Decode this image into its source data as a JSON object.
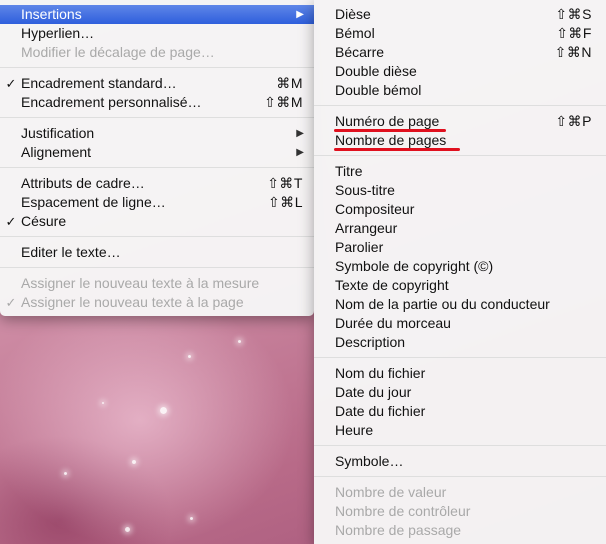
{
  "main_menu": {
    "items": [
      {
        "label": "Insertions",
        "submenu": true,
        "highlighted": true
      },
      {
        "label": "Hyperlien…"
      },
      {
        "label": "Modifier le décalage de page…",
        "disabled": true
      },
      {
        "label": "Encadrement standard…",
        "checked": true,
        "shortcut": "⌘M"
      },
      {
        "label": "Encadrement personnalisé…",
        "shortcut": "⇧⌘M"
      },
      {
        "label": "Justification",
        "submenu": true
      },
      {
        "label": "Alignement",
        "submenu": true
      },
      {
        "label": "Attributs de cadre…",
        "shortcut": "⇧⌘T"
      },
      {
        "label": "Espacement de ligne…",
        "shortcut": "⇧⌘L"
      },
      {
        "label": "Césure",
        "checked": true
      },
      {
        "label": "Editer le texte…"
      },
      {
        "label": "Assigner le nouveau texte à la mesure",
        "disabled": true
      },
      {
        "label": "Assigner le nouveau texte à la page",
        "disabled": true,
        "checked": true
      }
    ],
    "check_glyph": "✓",
    "arrow_glyph": "▶"
  },
  "sub_menu": {
    "items": [
      {
        "label": "Dièse",
        "shortcut": "⇧⌘S"
      },
      {
        "label": "Bémol",
        "shortcut": "⇧⌘F"
      },
      {
        "label": "Bécarre",
        "shortcut": "⇧⌘N"
      },
      {
        "label": "Double dièse"
      },
      {
        "label": "Double bémol"
      },
      {
        "label": "Numéro de page",
        "shortcut": "⇧⌘P",
        "underlined": true
      },
      {
        "label": "Nombre de pages",
        "underlined": true
      },
      {
        "label": "Titre"
      },
      {
        "label": "Sous-titre"
      },
      {
        "label": "Compositeur"
      },
      {
        "label": "Arrangeur"
      },
      {
        "label": "Parolier"
      },
      {
        "label": "Symbole de copyright (©)"
      },
      {
        "label": "Texte de copyright"
      },
      {
        "label": "Nom de la partie ou du conducteur"
      },
      {
        "label": "Durée du morceau"
      },
      {
        "label": "Description"
      },
      {
        "label": "Nom du fichier"
      },
      {
        "label": "Date du jour"
      },
      {
        "label": "Date du fichier"
      },
      {
        "label": "Heure"
      },
      {
        "label": "Symbole…"
      },
      {
        "label": "Nombre de valeur",
        "disabled": true
      },
      {
        "label": "Nombre de contrôleur",
        "disabled": true
      },
      {
        "label": "Nombre de passage",
        "disabled": true
      }
    ]
  },
  "colors": {
    "highlight": "#3a6ae0",
    "annotation_underline": "#e0101e",
    "disabled_text": "#a9a9a9"
  }
}
